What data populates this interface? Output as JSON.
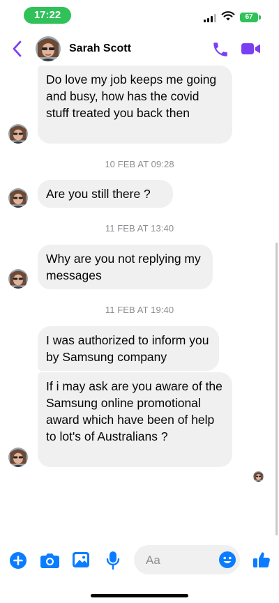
{
  "status_bar": {
    "time": "17:22",
    "battery": "67"
  },
  "header": {
    "contact_name": "Sarah Scott"
  },
  "messages": [
    {
      "text": "Do love my job keeps me going and busy, how has the covid stuff treated you back then"
    },
    {
      "timestamp": "10 FEB AT 09:28"
    },
    {
      "text": "Are you still there ?"
    },
    {
      "timestamp": "11 FEB AT 13:40"
    },
    {
      "text": "Why are you not replying my messages"
    },
    {
      "timestamp": "11 FEB AT 19:40"
    },
    {
      "text": "I was authorized to inform you by Samsung company"
    },
    {
      "text": "If i may ask are you aware of the Samsung online promotional award which have been of help to lot's of Australians ?"
    }
  ],
  "composer": {
    "placeholder": "Aa"
  },
  "colors": {
    "accent": "#7b3ff2",
    "messenger_blue": "#0a7cff",
    "bubble_gray": "#f0f0f0",
    "timestamp_gray": "#8a8d91",
    "status_green": "#30c159"
  },
  "icons": [
    "back-chevron-icon",
    "phone-icon",
    "video-camera-icon",
    "plus-icon",
    "camera-icon",
    "image-icon",
    "microphone-icon",
    "emoji-icon",
    "thumbs-up-icon"
  ]
}
